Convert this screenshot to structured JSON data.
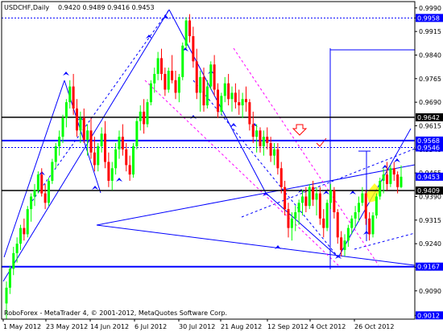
{
  "header": {
    "symbol": "USDCHF,Daily",
    "ohlc": "0.9420 0.9489 0.9416 0.9453"
  },
  "copyright": "RoboForex - MetaTrader 4, © 2001-2012, MetaQuotes Software Corp.",
  "colors": {
    "background": "#ffffff",
    "frame": "#000000",
    "bull_candle": "#00ff00",
    "bear_candle": "#ff0000",
    "trendline": "#0000ff",
    "dotted_level": "#0000ff",
    "magenta_channel": "#ff00ff",
    "price_box": "#0000ff",
    "highlight_box": "#ffff00"
  },
  "chart_data": {
    "type": "candlestick",
    "yaxis_side": "right",
    "ylim": [
      0.9,
      1.001
    ],
    "y_ticks": [
      "0.9990",
      "0.9958",
      "0.9915",
      "0.9840",
      "0.9765",
      "0.9690",
      "0.9615",
      "0.9540",
      "0.9465",
      "0.9390",
      "0.9315",
      "0.9240",
      "0.9165",
      "0.9090",
      "0.9012"
    ],
    "price_labels": [
      {
        "text": "0.9958",
        "value": 0.9958
      },
      {
        "text": "0.9642",
        "value": 0.9642
      },
      {
        "text": "0.9568",
        "value": 0.9568
      },
      {
        "text": "0.9546",
        "value": 0.9546
      },
      {
        "text": "0.9453",
        "value": 0.9453
      },
      {
        "text": "0.9409",
        "value": 0.9409
      },
      {
        "text": "0.9167",
        "value": 0.9167
      },
      {
        "text": "0.9012",
        "value": 0.9012
      }
    ],
    "x_labels": [
      "1 May 2012",
      "23 May 2012",
      "14 Jun 2012",
      "6 Jul 2012",
      "30 Jul 2012",
      "21 Aug 2012",
      "12 Sep 2012",
      "4 Oct 2012",
      "26 Oct 2012"
    ],
    "horizontal_levels": [
      {
        "value": 0.9642,
        "style": "solid-black"
      },
      {
        "value": 0.9568,
        "style": "solid-blue"
      },
      {
        "value": 0.9409,
        "style": "solid-black"
      },
      {
        "value": 0.9167,
        "style": "solid-blue"
      },
      {
        "value": 0.9958,
        "style": "dotted-blue"
      },
      {
        "value": 0.9546,
        "style": "dotted-blue"
      }
    ],
    "candles": [
      {
        "o": 0.905,
        "h": 0.912,
        "l": 0.9,
        "c": 0.91
      },
      {
        "o": 0.91,
        "h": 0.917,
        "l": 0.908,
        "c": 0.916
      },
      {
        "o": 0.916,
        "h": 0.923,
        "l": 0.914,
        "c": 0.921
      },
      {
        "o": 0.921,
        "h": 0.926,
        "l": 0.918,
        "c": 0.924
      },
      {
        "o": 0.924,
        "h": 0.93,
        "l": 0.922,
        "c": 0.929
      },
      {
        "o": 0.929,
        "h": 0.932,
        "l": 0.925,
        "c": 0.927
      },
      {
        "o": 0.927,
        "h": 0.936,
        "l": 0.926,
        "c": 0.935
      },
      {
        "o": 0.935,
        "h": 0.94,
        "l": 0.931,
        "c": 0.939
      },
      {
        "o": 0.939,
        "h": 0.943,
        "l": 0.936,
        "c": 0.941
      },
      {
        "o": 0.941,
        "h": 0.947,
        "l": 0.94,
        "c": 0.946
      },
      {
        "o": 0.946,
        "h": 0.948,
        "l": 0.939,
        "c": 0.94
      },
      {
        "o": 0.94,
        "h": 0.943,
        "l": 0.935,
        "c": 0.937
      },
      {
        "o": 0.937,
        "h": 0.945,
        "l": 0.936,
        "c": 0.944
      },
      {
        "o": 0.944,
        "h": 0.951,
        "l": 0.943,
        "c": 0.95
      },
      {
        "o": 0.95,
        "h": 0.956,
        "l": 0.948,
        "c": 0.955
      },
      {
        "o": 0.955,
        "h": 0.96,
        "l": 0.952,
        "c": 0.958
      },
      {
        "o": 0.958,
        "h": 0.965,
        "l": 0.956,
        "c": 0.964
      },
      {
        "o": 0.964,
        "h": 0.97,
        "l": 0.961,
        "c": 0.969
      },
      {
        "o": 0.969,
        "h": 0.976,
        "l": 0.967,
        "c": 0.974
      },
      {
        "o": 0.974,
        "h": 0.978,
        "l": 0.965,
        "c": 0.967
      },
      {
        "o": 0.967,
        "h": 0.97,
        "l": 0.958,
        "c": 0.96
      },
      {
        "o": 0.96,
        "h": 0.966,
        "l": 0.956,
        "c": 0.964
      },
      {
        "o": 0.964,
        "h": 0.967,
        "l": 0.956,
        "c": 0.957
      },
      {
        "o": 0.957,
        "h": 0.962,
        "l": 0.952,
        "c": 0.96
      },
      {
        "o": 0.96,
        "h": 0.964,
        "l": 0.951,
        "c": 0.953
      },
      {
        "o": 0.953,
        "h": 0.958,
        "l": 0.947,
        "c": 0.949
      },
      {
        "o": 0.949,
        "h": 0.956,
        "l": 0.947,
        "c": 0.955
      },
      {
        "o": 0.955,
        "h": 0.961,
        "l": 0.953,
        "c": 0.959
      },
      {
        "o": 0.959,
        "h": 0.963,
        "l": 0.948,
        "c": 0.95
      },
      {
        "o": 0.95,
        "h": 0.953,
        "l": 0.942,
        "c": 0.944
      },
      {
        "o": 0.944,
        "h": 0.95,
        "l": 0.941,
        "c": 0.948
      },
      {
        "o": 0.948,
        "h": 0.956,
        "l": 0.946,
        "c": 0.954
      },
      {
        "o": 0.954,
        "h": 0.96,
        "l": 0.951,
        "c": 0.958
      },
      {
        "o": 0.958,
        "h": 0.962,
        "l": 0.952,
        "c": 0.954
      },
      {
        "o": 0.954,
        "h": 0.956,
        "l": 0.947,
        "c": 0.949
      },
      {
        "o": 0.949,
        "h": 0.952,
        "l": 0.944,
        "c": 0.946
      },
      {
        "o": 0.946,
        "h": 0.956,
        "l": 0.945,
        "c": 0.955
      },
      {
        "o": 0.955,
        "h": 0.964,
        "l": 0.954,
        "c": 0.963
      },
      {
        "o": 0.963,
        "h": 0.968,
        "l": 0.96,
        "c": 0.966
      },
      {
        "o": 0.966,
        "h": 0.97,
        "l": 0.959,
        "c": 0.962
      },
      {
        "o": 0.962,
        "h": 0.97,
        "l": 0.961,
        "c": 0.969
      },
      {
        "o": 0.969,
        "h": 0.976,
        "l": 0.968,
        "c": 0.975
      },
      {
        "o": 0.975,
        "h": 0.98,
        "l": 0.972,
        "c": 0.978
      },
      {
        "o": 0.978,
        "h": 0.985,
        "l": 0.976,
        "c": 0.983
      },
      {
        "o": 0.983,
        "h": 0.986,
        "l": 0.976,
        "c": 0.978
      },
      {
        "o": 0.978,
        "h": 0.98,
        "l": 0.971,
        "c": 0.973
      },
      {
        "o": 0.973,
        "h": 0.98,
        "l": 0.972,
        "c": 0.979
      },
      {
        "o": 0.979,
        "h": 0.984,
        "l": 0.975,
        "c": 0.976
      },
      {
        "o": 0.976,
        "h": 0.979,
        "l": 0.97,
        "c": 0.972
      },
      {
        "o": 0.972,
        "h": 0.978,
        "l": 0.969,
        "c": 0.977
      },
      {
        "o": 0.977,
        "h": 0.988,
        "l": 0.976,
        "c": 0.987
      },
      {
        "o": 0.987,
        "h": 0.996,
        "l": 0.986,
        "c": 0.995
      },
      {
        "o": 0.995,
        "h": 0.997,
        "l": 0.988,
        "c": 0.99
      },
      {
        "o": 0.99,
        "h": 0.993,
        "l": 0.98,
        "c": 0.982
      },
      {
        "o": 0.982,
        "h": 0.986,
        "l": 0.97,
        "c": 0.972
      },
      {
        "o": 0.972,
        "h": 0.979,
        "l": 0.966,
        "c": 0.977
      },
      {
        "o": 0.977,
        "h": 0.98,
        "l": 0.966,
        "c": 0.968
      },
      {
        "o": 0.968,
        "h": 0.976,
        "l": 0.967,
        "c": 0.974
      },
      {
        "o": 0.974,
        "h": 0.982,
        "l": 0.973,
        "c": 0.981
      },
      {
        "o": 0.981,
        "h": 0.984,
        "l": 0.971,
        "c": 0.973
      },
      {
        "o": 0.973,
        "h": 0.975,
        "l": 0.964,
        "c": 0.966
      },
      {
        "o": 0.966,
        "h": 0.972,
        "l": 0.965,
        "c": 0.971
      },
      {
        "o": 0.971,
        "h": 0.977,
        "l": 0.969,
        "c": 0.975
      },
      {
        "o": 0.975,
        "h": 0.978,
        "l": 0.968,
        "c": 0.97
      },
      {
        "o": 0.97,
        "h": 0.974,
        "l": 0.966,
        "c": 0.972
      },
      {
        "o": 0.972,
        "h": 0.975,
        "l": 0.967,
        "c": 0.969
      },
      {
        "o": 0.969,
        "h": 0.973,
        "l": 0.965,
        "c": 0.968
      },
      {
        "o": 0.968,
        "h": 0.972,
        "l": 0.964,
        "c": 0.97
      },
      {
        "o": 0.97,
        "h": 0.974,
        "l": 0.966,
        "c": 0.969
      },
      {
        "o": 0.969,
        "h": 0.97,
        "l": 0.96,
        "c": 0.962
      },
      {
        "o": 0.962,
        "h": 0.966,
        "l": 0.956,
        "c": 0.958
      },
      {
        "o": 0.958,
        "h": 0.962,
        "l": 0.953,
        "c": 0.96
      },
      {
        "o": 0.96,
        "h": 0.961,
        "l": 0.953,
        "c": 0.955
      },
      {
        "o": 0.955,
        "h": 0.96,
        "l": 0.952,
        "c": 0.958
      },
      {
        "o": 0.958,
        "h": 0.961,
        "l": 0.954,
        "c": 0.956
      },
      {
        "o": 0.956,
        "h": 0.958,
        "l": 0.95,
        "c": 0.952
      },
      {
        "o": 0.952,
        "h": 0.956,
        "l": 0.949,
        "c": 0.954
      },
      {
        "o": 0.954,
        "h": 0.956,
        "l": 0.946,
        "c": 0.948
      },
      {
        "o": 0.948,
        "h": 0.95,
        "l": 0.94,
        "c": 0.942
      },
      {
        "o": 0.942,
        "h": 0.944,
        "l": 0.933,
        "c": 0.935
      },
      {
        "o": 0.935,
        "h": 0.937,
        "l": 0.926,
        "c": 0.929
      },
      {
        "o": 0.929,
        "h": 0.934,
        "l": 0.925,
        "c": 0.932
      },
      {
        "o": 0.932,
        "h": 0.936,
        "l": 0.928,
        "c": 0.934
      },
      {
        "o": 0.934,
        "h": 0.938,
        "l": 0.93,
        "c": 0.937
      },
      {
        "o": 0.937,
        "h": 0.941,
        "l": 0.933,
        "c": 0.939
      },
      {
        "o": 0.939,
        "h": 0.942,
        "l": 0.934,
        "c": 0.936
      },
      {
        "o": 0.936,
        "h": 0.943,
        "l": 0.935,
        "c": 0.942
      },
      {
        "o": 0.942,
        "h": 0.944,
        "l": 0.936,
        "c": 0.938
      },
      {
        "o": 0.938,
        "h": 0.942,
        "l": 0.933,
        "c": 0.94
      },
      {
        "o": 0.94,
        "h": 0.942,
        "l": 0.93,
        "c": 0.932
      },
      {
        "o": 0.932,
        "h": 0.935,
        "l": 0.926,
        "c": 0.929
      },
      {
        "o": 0.929,
        "h": 0.938,
        "l": 0.928,
        "c": 0.937
      },
      {
        "o": 0.937,
        "h": 0.943,
        "l": 0.935,
        "c": 0.941
      },
      {
        "o": 0.941,
        "h": 0.942,
        "l": 0.932,
        "c": 0.934
      },
      {
        "o": 0.934,
        "h": 0.935,
        "l": 0.924,
        "c": 0.926
      },
      {
        "o": 0.926,
        "h": 0.928,
        "l": 0.92,
        "c": 0.922
      },
      {
        "o": 0.922,
        "h": 0.927,
        "l": 0.92,
        "c": 0.925
      },
      {
        "o": 0.925,
        "h": 0.93,
        "l": 0.923,
        "c": 0.929
      },
      {
        "o": 0.929,
        "h": 0.933,
        "l": 0.927,
        "c": 0.932
      },
      {
        "o": 0.932,
        "h": 0.936,
        "l": 0.929,
        "c": 0.934
      },
      {
        "o": 0.934,
        "h": 0.939,
        "l": 0.931,
        "c": 0.937
      },
      {
        "o": 0.937,
        "h": 0.942,
        "l": 0.936,
        "c": 0.94
      },
      {
        "o": 0.94,
        "h": 0.941,
        "l": 0.93,
        "c": 0.932
      },
      {
        "o": 0.932,
        "h": 0.934,
        "l": 0.925,
        "c": 0.927
      },
      {
        "o": 0.927,
        "h": 0.934,
        "l": 0.926,
        "c": 0.933
      },
      {
        "o": 0.933,
        "h": 0.94,
        "l": 0.932,
        "c": 0.939
      },
      {
        "o": 0.939,
        "h": 0.945,
        "l": 0.938,
        "c": 0.944
      },
      {
        "o": 0.944,
        "h": 0.948,
        "l": 0.94,
        "c": 0.946
      },
      {
        "o": 0.946,
        "h": 0.95,
        "l": 0.941,
        "c": 0.943
      },
      {
        "o": 0.943,
        "h": 0.949,
        "l": 0.942,
        "c": 0.948
      },
      {
        "o": 0.948,
        "h": 0.95,
        "l": 0.944,
        "c": 0.946
      },
      {
        "o": 0.946,
        "h": 0.947,
        "l": 0.94,
        "c": 0.942
      },
      {
        "o": 0.942,
        "h": 0.9489,
        "l": 0.9416,
        "c": 0.9453
      }
    ]
  }
}
